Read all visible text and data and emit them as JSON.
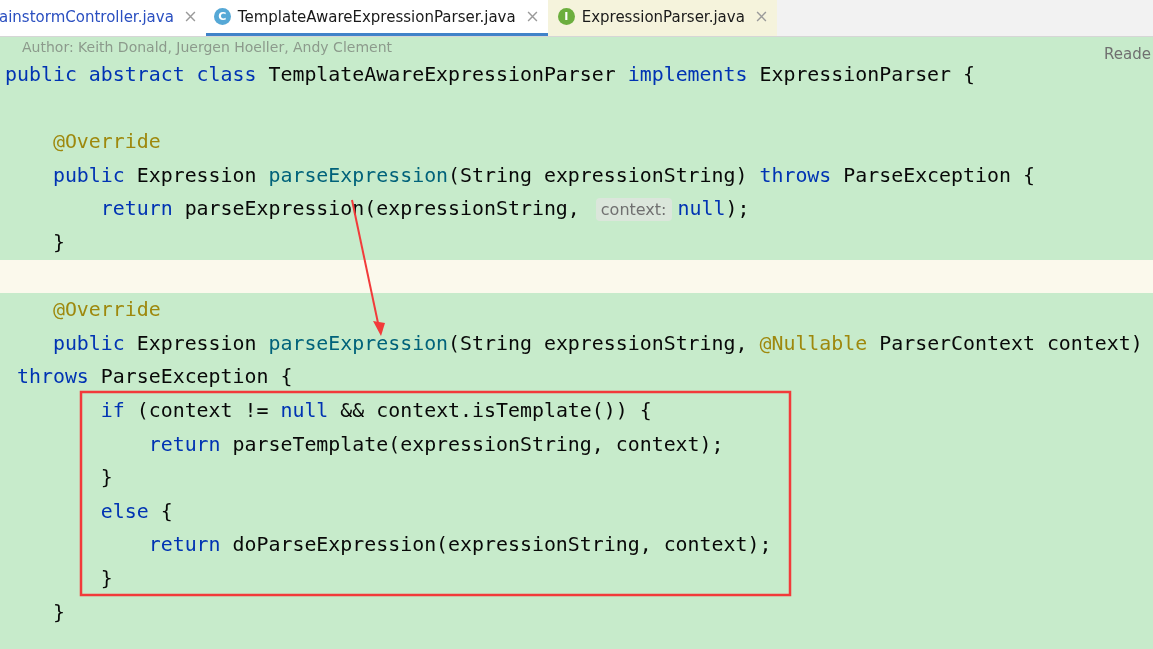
{
  "tabs": [
    {
      "label": "ainstormController.java",
      "selected": false
    },
    {
      "label": "TemplateAwareExpressionParser.java",
      "selected": true,
      "icon_letter": "C",
      "color": "#56a8d6"
    },
    {
      "label": "ExpressionParser.java",
      "selected": false,
      "icon_letter": "I",
      "color": "#6cae3e"
    }
  ],
  "editor": {
    "doc_comment": "Author: Keith Donald, Juergen Hoeller, Andy Clement",
    "reader_mode": "Reade",
    "lines": [
      {
        "current": false,
        "tokens": [
          {
            "kind": "keyword",
            "text": "public abstract class "
          },
          {
            "kind": "plain",
            "text": "TemplateAwareExpressionParser "
          },
          {
            "kind": "keyword",
            "text": "implements "
          },
          {
            "kind": "plain",
            "text": "ExpressionParser {"
          }
        ]
      },
      {
        "current": false
      },
      {
        "current": false,
        "tokens": [
          {
            "kind": "annotation",
            "text": "    @Override"
          }
        ]
      },
      {
        "current": false,
        "tokens": [
          {
            "kind": "keyword",
            "text": "    public "
          },
          {
            "kind": "plain",
            "text": "Expression "
          },
          {
            "kind": "method",
            "text": "parseExpression"
          },
          {
            "kind": "plain",
            "text": "(String expressionString) "
          },
          {
            "kind": "keyword",
            "text": "throws "
          },
          {
            "kind": "plain",
            "text": "ParseException {"
          }
        ]
      },
      {
        "current": false,
        "tokens": [
          {
            "kind": "keyword",
            "text": "        return "
          },
          {
            "kind": "plain",
            "text": "parseExpression(expressionString, "
          },
          {
            "kind": "hint",
            "text": "context:"
          },
          {
            "kind": "keyword",
            "text": "null"
          },
          {
            "kind": "plain",
            "text": ");"
          }
        ]
      },
      {
        "current": false,
        "tokens": [
          {
            "kind": "plain",
            "text": "    }"
          }
        ]
      },
      {
        "current": true
      },
      {
        "current": false,
        "tokens": [
          {
            "kind": "annotation",
            "text": "    @Override"
          }
        ]
      },
      {
        "current": false,
        "tokens": [
          {
            "kind": "keyword",
            "text": "    public "
          },
          {
            "kind": "plain",
            "text": "Expression "
          },
          {
            "kind": "method",
            "text": "parseExpression"
          },
          {
            "kind": "plain",
            "text": "(String expressionString, "
          },
          {
            "kind": "annotation",
            "text": "@Nullable "
          },
          {
            "kind": "plain",
            "text": "ParserContext context)"
          }
        ]
      },
      {
        "current": false,
        "tokens": [
          {
            "kind": "keyword",
            "text": " throws "
          },
          {
            "kind": "plain",
            "text": "ParseException {"
          }
        ]
      },
      {
        "current": false,
        "tokens": [
          {
            "kind": "keyword",
            "text": "        if "
          },
          {
            "kind": "plain",
            "text": "(context != "
          },
          {
            "kind": "keyword",
            "text": "null "
          },
          {
            "kind": "plain",
            "text": "&& context.isTemplate()) {"
          }
        ]
      },
      {
        "current": false,
        "tokens": [
          {
            "kind": "keyword",
            "text": "            return "
          },
          {
            "kind": "plain",
            "text": "parseTemplate(expressionString, context);"
          }
        ]
      },
      {
        "current": false,
        "tokens": [
          {
            "kind": "plain",
            "text": "        }"
          }
        ]
      },
      {
        "current": false,
        "tokens": [
          {
            "kind": "keyword",
            "text": "        else "
          },
          {
            "kind": "plain",
            "text": "{"
          }
        ]
      },
      {
        "current": false,
        "tokens": [
          {
            "kind": "keyword",
            "text": "            return "
          },
          {
            "kind": "plain",
            "text": "doParseExpression(expressionString, context);"
          }
        ]
      },
      {
        "current": false,
        "tokens": [
          {
            "kind": "plain",
            "text": "        }"
          }
        ]
      },
      {
        "current": false,
        "tokens": [
          {
            "kind": "plain",
            "text": "    }"
          }
        ]
      }
    ]
  }
}
